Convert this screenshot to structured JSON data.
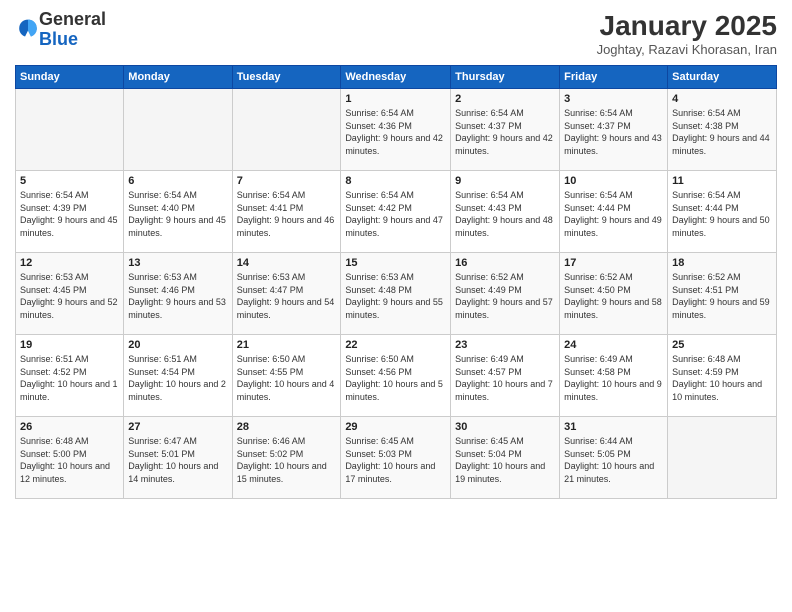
{
  "logo": {
    "general": "General",
    "blue": "Blue"
  },
  "title": "January 2025",
  "subtitle": "Joghtay, Razavi Khorasan, Iran",
  "days_of_week": [
    "Sunday",
    "Monday",
    "Tuesday",
    "Wednesday",
    "Thursday",
    "Friday",
    "Saturday"
  ],
  "weeks": [
    [
      {
        "day": "",
        "info": ""
      },
      {
        "day": "",
        "info": ""
      },
      {
        "day": "",
        "info": ""
      },
      {
        "day": "1",
        "info": "Sunrise: 6:54 AM\nSunset: 4:36 PM\nDaylight: 9 hours and 42 minutes."
      },
      {
        "day": "2",
        "info": "Sunrise: 6:54 AM\nSunset: 4:37 PM\nDaylight: 9 hours and 42 minutes."
      },
      {
        "day": "3",
        "info": "Sunrise: 6:54 AM\nSunset: 4:37 PM\nDaylight: 9 hours and 43 minutes."
      },
      {
        "day": "4",
        "info": "Sunrise: 6:54 AM\nSunset: 4:38 PM\nDaylight: 9 hours and 44 minutes."
      }
    ],
    [
      {
        "day": "5",
        "info": "Sunrise: 6:54 AM\nSunset: 4:39 PM\nDaylight: 9 hours and 45 minutes."
      },
      {
        "day": "6",
        "info": "Sunrise: 6:54 AM\nSunset: 4:40 PM\nDaylight: 9 hours and 45 minutes."
      },
      {
        "day": "7",
        "info": "Sunrise: 6:54 AM\nSunset: 4:41 PM\nDaylight: 9 hours and 46 minutes."
      },
      {
        "day": "8",
        "info": "Sunrise: 6:54 AM\nSunset: 4:42 PM\nDaylight: 9 hours and 47 minutes."
      },
      {
        "day": "9",
        "info": "Sunrise: 6:54 AM\nSunset: 4:43 PM\nDaylight: 9 hours and 48 minutes."
      },
      {
        "day": "10",
        "info": "Sunrise: 6:54 AM\nSunset: 4:44 PM\nDaylight: 9 hours and 49 minutes."
      },
      {
        "day": "11",
        "info": "Sunrise: 6:54 AM\nSunset: 4:44 PM\nDaylight: 9 hours and 50 minutes."
      }
    ],
    [
      {
        "day": "12",
        "info": "Sunrise: 6:53 AM\nSunset: 4:45 PM\nDaylight: 9 hours and 52 minutes."
      },
      {
        "day": "13",
        "info": "Sunrise: 6:53 AM\nSunset: 4:46 PM\nDaylight: 9 hours and 53 minutes."
      },
      {
        "day": "14",
        "info": "Sunrise: 6:53 AM\nSunset: 4:47 PM\nDaylight: 9 hours and 54 minutes."
      },
      {
        "day": "15",
        "info": "Sunrise: 6:53 AM\nSunset: 4:48 PM\nDaylight: 9 hours and 55 minutes."
      },
      {
        "day": "16",
        "info": "Sunrise: 6:52 AM\nSunset: 4:49 PM\nDaylight: 9 hours and 57 minutes."
      },
      {
        "day": "17",
        "info": "Sunrise: 6:52 AM\nSunset: 4:50 PM\nDaylight: 9 hours and 58 minutes."
      },
      {
        "day": "18",
        "info": "Sunrise: 6:52 AM\nSunset: 4:51 PM\nDaylight: 9 hours and 59 minutes."
      }
    ],
    [
      {
        "day": "19",
        "info": "Sunrise: 6:51 AM\nSunset: 4:52 PM\nDaylight: 10 hours and 1 minute."
      },
      {
        "day": "20",
        "info": "Sunrise: 6:51 AM\nSunset: 4:54 PM\nDaylight: 10 hours and 2 minutes."
      },
      {
        "day": "21",
        "info": "Sunrise: 6:50 AM\nSunset: 4:55 PM\nDaylight: 10 hours and 4 minutes."
      },
      {
        "day": "22",
        "info": "Sunrise: 6:50 AM\nSunset: 4:56 PM\nDaylight: 10 hours and 5 minutes."
      },
      {
        "day": "23",
        "info": "Sunrise: 6:49 AM\nSunset: 4:57 PM\nDaylight: 10 hours and 7 minutes."
      },
      {
        "day": "24",
        "info": "Sunrise: 6:49 AM\nSunset: 4:58 PM\nDaylight: 10 hours and 9 minutes."
      },
      {
        "day": "25",
        "info": "Sunrise: 6:48 AM\nSunset: 4:59 PM\nDaylight: 10 hours and 10 minutes."
      }
    ],
    [
      {
        "day": "26",
        "info": "Sunrise: 6:48 AM\nSunset: 5:00 PM\nDaylight: 10 hours and 12 minutes."
      },
      {
        "day": "27",
        "info": "Sunrise: 6:47 AM\nSunset: 5:01 PM\nDaylight: 10 hours and 14 minutes."
      },
      {
        "day": "28",
        "info": "Sunrise: 6:46 AM\nSunset: 5:02 PM\nDaylight: 10 hours and 15 minutes."
      },
      {
        "day": "29",
        "info": "Sunrise: 6:45 AM\nSunset: 5:03 PM\nDaylight: 10 hours and 17 minutes."
      },
      {
        "day": "30",
        "info": "Sunrise: 6:45 AM\nSunset: 5:04 PM\nDaylight: 10 hours and 19 minutes."
      },
      {
        "day": "31",
        "info": "Sunrise: 6:44 AM\nSunset: 5:05 PM\nDaylight: 10 hours and 21 minutes."
      },
      {
        "day": "",
        "info": ""
      }
    ]
  ]
}
